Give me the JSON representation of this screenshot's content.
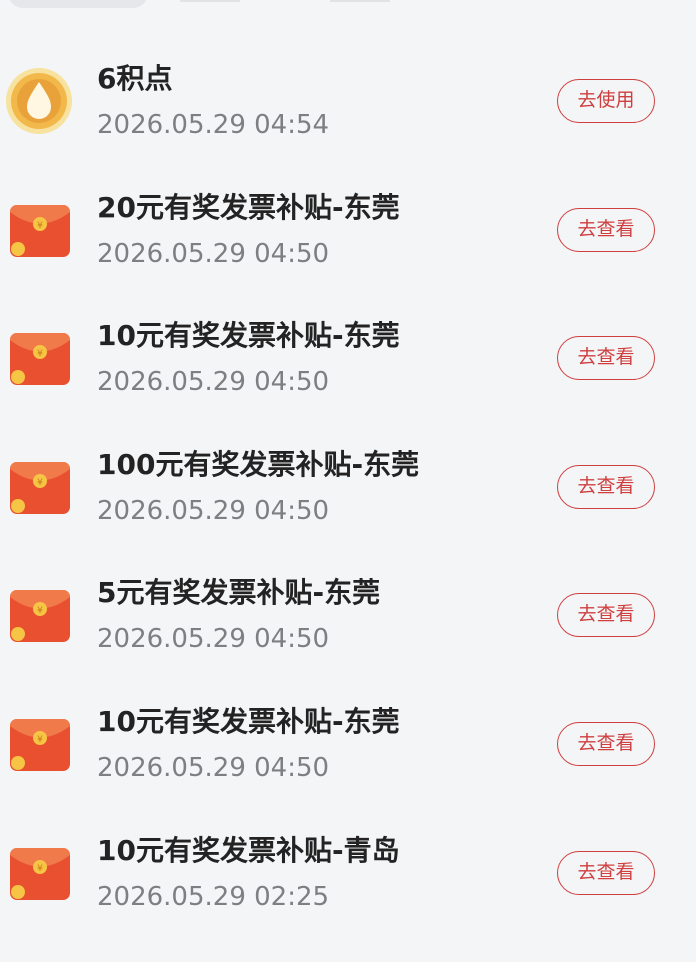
{
  "list": {
    "items": [
      {
        "icon": "points-drop-icon",
        "title": "6积点",
        "time": "2026.05.29 04:54",
        "action": "去使用"
      },
      {
        "icon": "red-envelope-icon",
        "title": "20元有奖发票补贴-东莞",
        "time": "2026.05.29 04:50",
        "action": "去查看"
      },
      {
        "icon": "red-envelope-icon",
        "title": "10元有奖发票补贴-东莞",
        "time": "2026.05.29 04:50",
        "action": "去查看"
      },
      {
        "icon": "red-envelope-icon",
        "title": "100元有奖发票补贴-东莞",
        "time": "2026.05.29 04:50",
        "action": "去查看"
      },
      {
        "icon": "red-envelope-icon",
        "title": "5元有奖发票补贴-东莞",
        "time": "2026.05.29 04:50",
        "action": "去查看"
      },
      {
        "icon": "red-envelope-icon",
        "title": "10元有奖发票补贴-东莞",
        "time": "2026.05.29 04:50",
        "action": "去查看"
      },
      {
        "icon": "red-envelope-icon",
        "title": "10元有奖发票补贴-青岛",
        "time": "2026.05.29 02:25",
        "action": "去查看"
      }
    ]
  },
  "colors": {
    "accent": "#cf3f3f",
    "background": "#f4f5f7",
    "title": "#232323",
    "time": "#7e7e83"
  }
}
